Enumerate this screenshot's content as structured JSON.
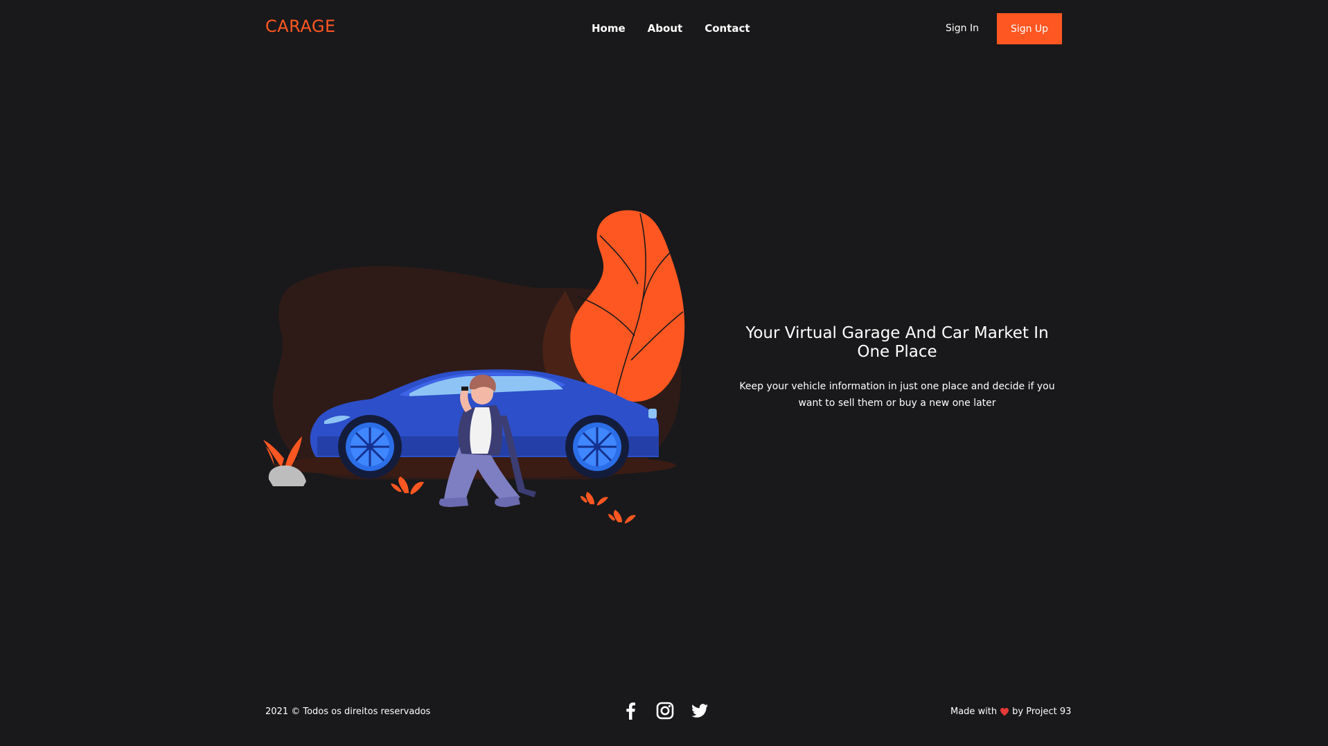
{
  "header": {
    "logo": "CARAGE",
    "nav": [
      {
        "label": "Home"
      },
      {
        "label": "About"
      },
      {
        "label": "Contact"
      }
    ],
    "sign_in": "Sign In",
    "sign_up": "Sign Up"
  },
  "hero": {
    "title": "Your Virtual Garage And Car Market In One Place",
    "description": "Keep your vehicle information in just one place and decide if you want to sell them or buy a new one later",
    "illustration": "car-with-person-illustration"
  },
  "footer": {
    "copyright": "2021 © Todos os direitos reservados",
    "socials": [
      "facebook-icon",
      "instagram-icon",
      "twitter-icon"
    ],
    "made_with_prefix": "Made with",
    "made_with_icon": "heart-icon",
    "made_with_suffix": "by Project 93"
  },
  "colors": {
    "accent": "#ff5722",
    "background": "#19191b",
    "text": "#ffffff",
    "car": "#2d4fc9"
  }
}
